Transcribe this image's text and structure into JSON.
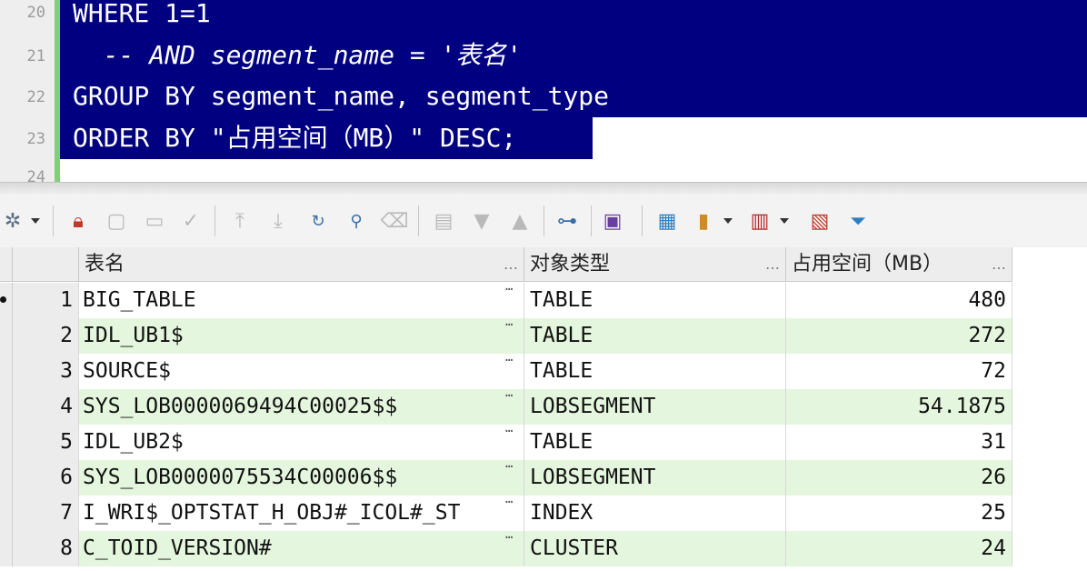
{
  "editor": {
    "lines": [
      {
        "number": "20",
        "text": "WHERE 1=1"
      },
      {
        "number": "21",
        "text": "  -- AND segment_name = '表名'"
      },
      {
        "number": "22",
        "text": "GROUP BY segment_name, segment_type"
      },
      {
        "number": "23",
        "text": "ORDER BY \"占用空间（MB）\" DESC;"
      },
      {
        "number": "24",
        "text": ""
      }
    ],
    "colors": {
      "selection": "#000080",
      "gutter_bar": "#7fd07a"
    }
  },
  "toolbar": {
    "icons": [
      "settings-icon",
      "lock-icon",
      "insert-row-icon",
      "delete-row-icon",
      "post-changes-icon",
      "first-record-icon",
      "last-record-icon",
      "refresh-icon",
      "find-icon",
      "clear-icon",
      "export-icon",
      "next-icon",
      "previous-icon",
      "query-plan-icon",
      "save-icon",
      "single-record-icon",
      "chart-icon",
      "book-icon",
      "compare-icon",
      "filter-icon"
    ]
  },
  "grid": {
    "columns": [
      "表名",
      "对象类型",
      "占用空间（MB）"
    ],
    "rows": [
      {
        "n": "1",
        "name": "BIG_TABLE",
        "type": "TABLE",
        "size": "480"
      },
      {
        "n": "2",
        "name": "IDL_UB1$",
        "type": "TABLE",
        "size": "272"
      },
      {
        "n": "3",
        "name": "SOURCE$",
        "type": "TABLE",
        "size": "72"
      },
      {
        "n": "4",
        "name": "SYS_LOB0000069494C00025$$",
        "type": "LOBSEGMENT",
        "size": "54.1875"
      },
      {
        "n": "5",
        "name": "IDL_UB2$",
        "type": "TABLE",
        "size": "31"
      },
      {
        "n": "6",
        "name": "SYS_LOB0000075534C00006$$",
        "type": "LOBSEGMENT",
        "size": "26"
      },
      {
        "n": "7",
        "name": "I_WRI$_OPTSTAT_H_OBJ#_ICOL#_ST",
        "type": "INDEX",
        "size": "25"
      },
      {
        "n": "8",
        "name": "C_TOID_VERSION#",
        "type": "CLUSTER",
        "size": "24"
      }
    ],
    "colors": {
      "alt_row": "#e4f6dd",
      "header": "#ededed"
    }
  }
}
